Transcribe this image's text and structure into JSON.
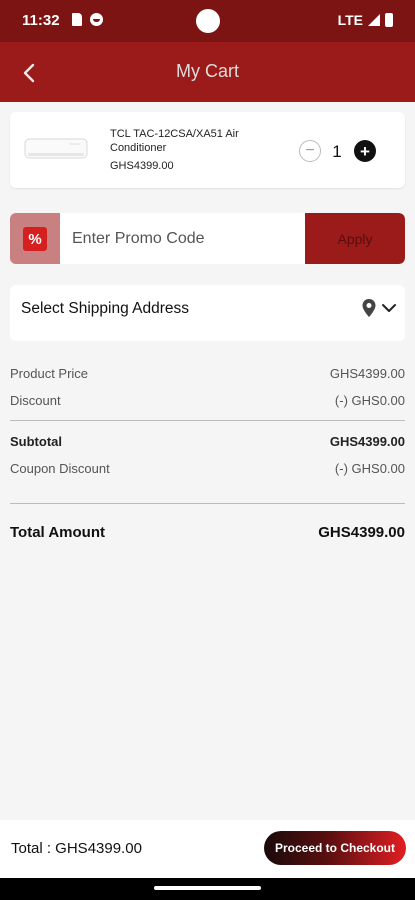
{
  "status": {
    "time": "11:32",
    "network": "LTE"
  },
  "header": {
    "title": "My Cart"
  },
  "cart": {
    "items": [
      {
        "name": "TCL TAC-12CSA/XA51 Air Conditioner",
        "price": "GHS4399.00",
        "quantity": "1",
        "minus_label": "−",
        "plus_label": "+"
      }
    ]
  },
  "promo": {
    "icon_label": "%",
    "placeholder": "Enter Promo Code",
    "apply_label": "Apply"
  },
  "shipping": {
    "label": "Select Shipping Address"
  },
  "summary": {
    "product_price_label": "Product Price",
    "product_price_value": "GHS4399.00",
    "discount_label": "Discount",
    "discount_value": "(-) GHS0.00",
    "subtotal_label": "Subtotal",
    "subtotal_value": "GHS4399.00",
    "coupon_label": "Coupon Discount",
    "coupon_value": "(-) GHS0.00",
    "total_label": "Total Amount",
    "total_value": "GHS4399.00"
  },
  "footer": {
    "total_text": "Total : GHS4399.00",
    "checkout_label": "Proceed to Checkout"
  },
  "colors": {
    "primary": "#9b1b1b",
    "status_bar": "#7c1414",
    "accent_red": "#e11e22",
    "background": "#f5f5f5"
  }
}
